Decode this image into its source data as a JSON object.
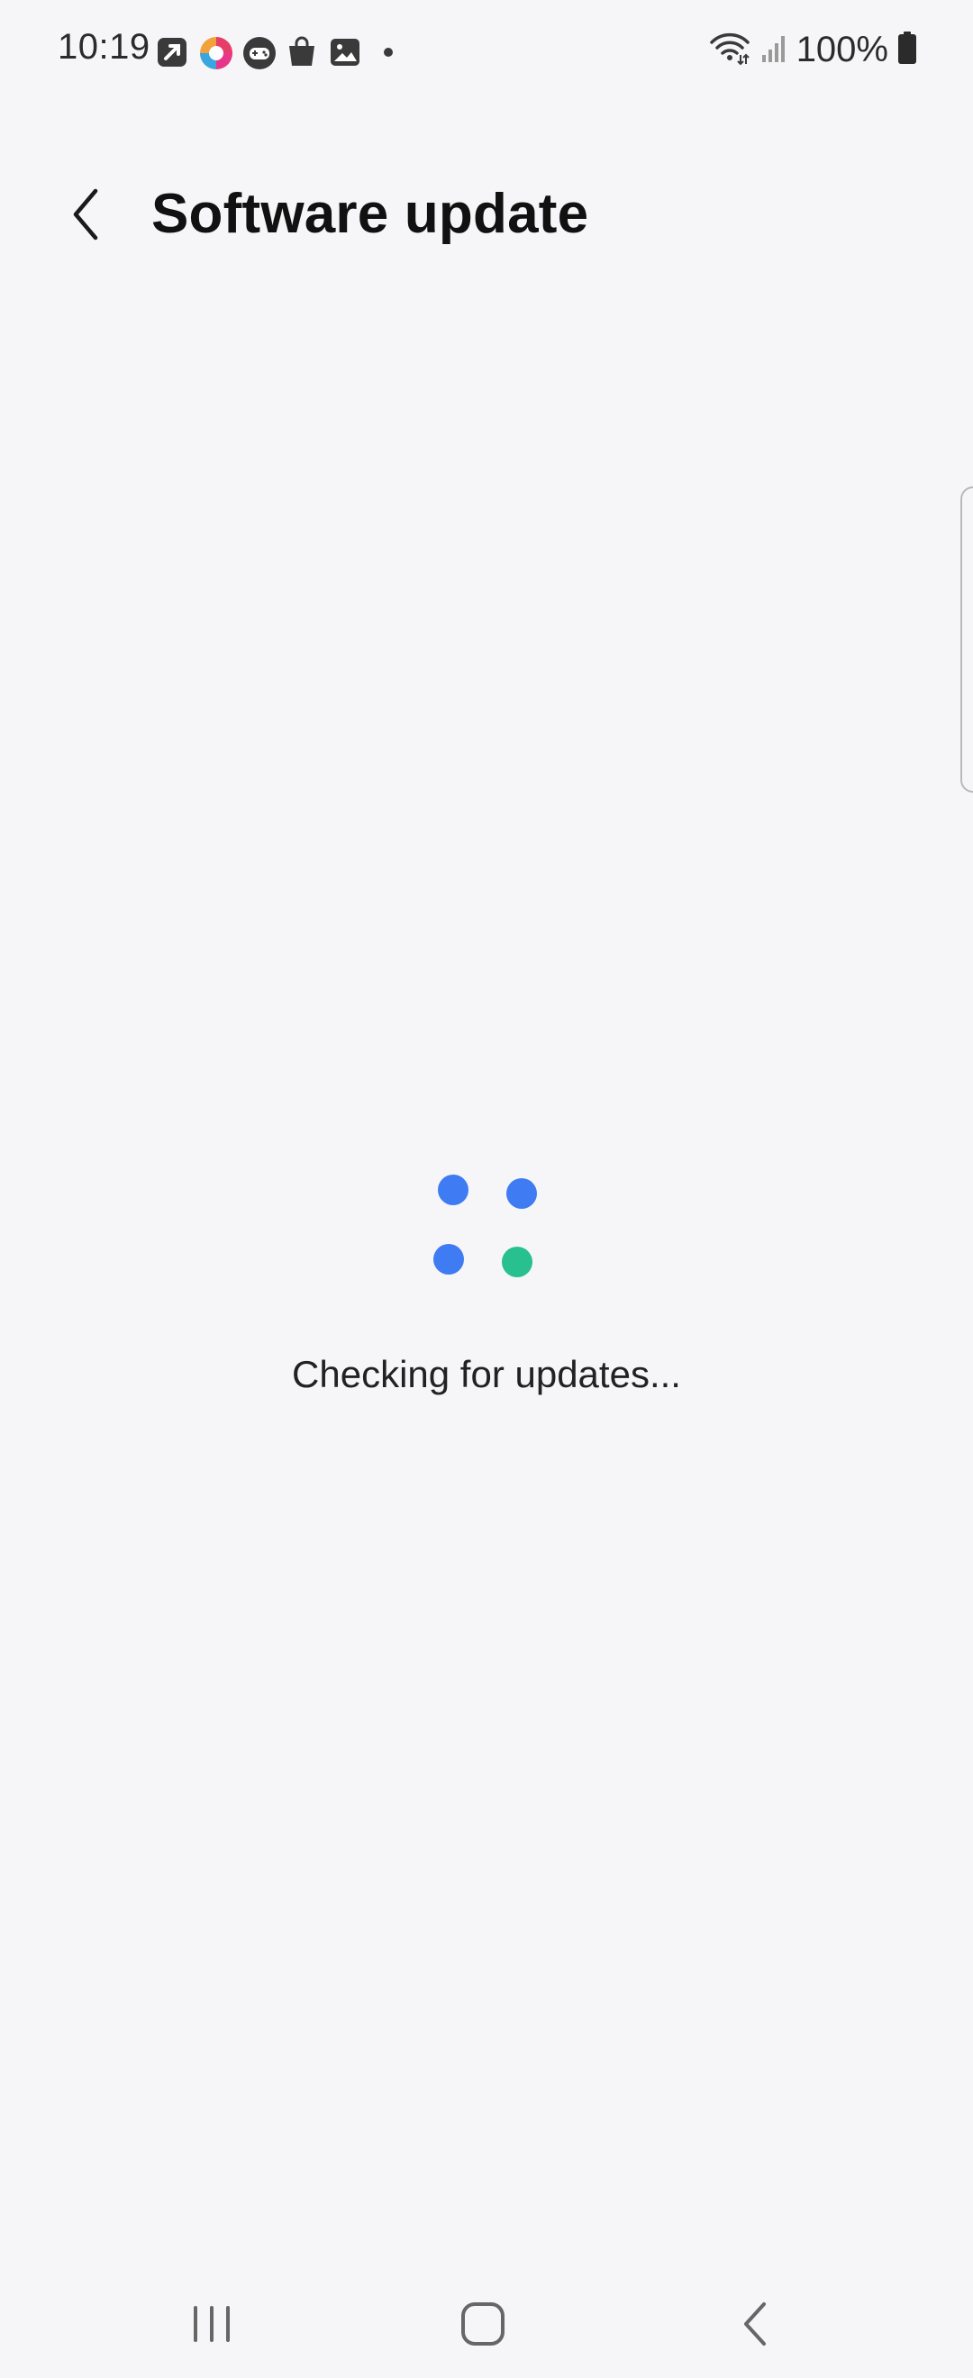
{
  "status_bar": {
    "time": "10:19",
    "notification_icons": [
      "arrow-square-icon",
      "colorful-app-icon",
      "gamepad-icon",
      "shopping-bag-icon",
      "gallery-icon",
      "more-dot-icon"
    ],
    "battery_percent": "100%",
    "system_icons": [
      "wifi-icon",
      "signal-icon",
      "battery-icon"
    ]
  },
  "header": {
    "title": "Software update",
    "back_icon": "chevron-left-icon"
  },
  "main": {
    "status_text": "Checking for updates..."
  },
  "loader": {
    "dot_colors": [
      "#3f7bf2",
      "#3f7bf2",
      "#3f7bf2",
      "#27c08e"
    ]
  },
  "nav_bar": {
    "buttons": [
      "recent-apps-icon",
      "home-icon",
      "back-icon"
    ]
  },
  "colors": {
    "background": "#f6f6f8",
    "accent_blue": "#3f7bf2",
    "accent_green": "#27c08e",
    "text_primary": "#111111"
  }
}
